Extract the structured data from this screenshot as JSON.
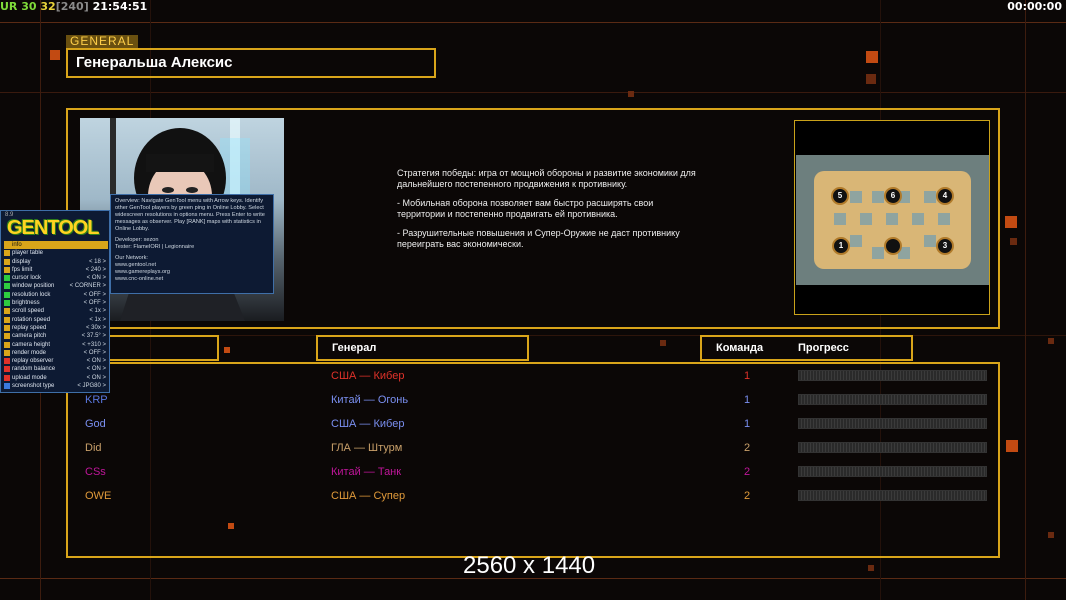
{
  "status": {
    "ur": "UR",
    "fps_a": "30",
    "fps_b": "32",
    "fps_cap": "[240]",
    "clock": "21:54:51",
    "game_time": "00:00:00"
  },
  "general": {
    "tag": "GENERAL",
    "name": "Генеральша Алексис",
    "strategy_paragraphs": [
      "Стратегия победы: игра от мощной обороны и развитие экономики для дальнейшего постепенного продвижения к противнику.",
      "- Мобильная оборона позволяет вам быстро расширять свои территории и постепенно продвигать ей противника.",
      "- Разрушительные повышения и Супер-Оружие не даст противнику переиграть вас экономически."
    ]
  },
  "map": {
    "spots": [
      "1",
      "2",
      "3",
      "4",
      "5",
      "6"
    ]
  },
  "table": {
    "headers": {
      "general": "Генерал",
      "team": "Команда",
      "progress": "Прогресс"
    },
    "rows": [
      {
        "name": "",
        "general": "США — Кибер",
        "team": "1",
        "name_color": "#e0322a",
        "general_color": "#e0322a"
      },
      {
        "name": "KRP",
        "general": "Китай — Огонь",
        "team": "1",
        "name_color": "#5a78e0",
        "general_color": "#7a8ff0"
      },
      {
        "name": "God",
        "general": "США — Кибер",
        "team": "1",
        "name_color": "#7a8ff0",
        "general_color": "#7a8ff0"
      },
      {
        "name": "Did",
        "general": "ГЛА — Штурм",
        "team": "2",
        "name_color": "#c9a06a",
        "general_color": "#c9a06a"
      },
      {
        "name": "CSs",
        "general": "Китай — Танк",
        "team": "2",
        "name_color": "#c0169a",
        "general_color": "#c0169a"
      },
      {
        "name": "OWE",
        "general": "США — Супер",
        "team": "2",
        "name_color": "#e09a3a",
        "general_color": "#e09a3a"
      }
    ]
  },
  "gentool": {
    "logo": "GENTOOL",
    "version": "8.9",
    "menu": [
      {
        "label": "info",
        "value": "",
        "color": "#d9a51a",
        "selected": true
      },
      {
        "label": "player table",
        "value": "",
        "color": "#d9a51a"
      },
      {
        "label": "display",
        "value": "< 18 >",
        "color": "#d9a51a"
      },
      {
        "label": "fps limit",
        "value": "< 240 >",
        "color": "#d9a51a"
      },
      {
        "label": "cursor lock",
        "value": "< ON >",
        "color": "#2ecc40"
      },
      {
        "label": "window position",
        "value": "< CORNER >",
        "color": "#2ecc40"
      },
      {
        "label": "resolution lock",
        "value": "< OFF >",
        "color": "#2ecc40"
      },
      {
        "label": "brightness",
        "value": "< OFF >",
        "color": "#2ecc40"
      },
      {
        "label": "scroll speed",
        "value": "< 1x >",
        "color": "#d9a51a"
      },
      {
        "label": "rotation speed",
        "value": "< 1x >",
        "color": "#d9a51a"
      },
      {
        "label": "replay speed",
        "value": "< 30x >",
        "color": "#d9a51a"
      },
      {
        "label": "camera pitch",
        "value": "< 37.5° >",
        "color": "#d9a51a"
      },
      {
        "label": "camera height",
        "value": "< +310 >",
        "color": "#d9a51a"
      },
      {
        "label": "render mode",
        "value": "< OFF >",
        "color": "#d9a51a"
      },
      {
        "label": "replay observer",
        "value": "< ON >",
        "color": "#e0322a"
      },
      {
        "label": "random balance",
        "value": "< ON >",
        "color": "#e0322a"
      },
      {
        "label": "upload mode",
        "value": "< ON >",
        "color": "#e0322a"
      },
      {
        "label": "screenshot type",
        "value": "< JPG80 >",
        "color": "#3a7ae0"
      }
    ],
    "help": [
      "Overview: Navigate GenTool menu with Arrow keys. Identify other GenTool players by green ping in Online Lobby. Select widescreen resolutions in options menu. Press Enter to write messages as observer. Play [RANK] maps with statistics in Online Lobby.",
      "Developer: xezon",
      "Tester: FlameIORI | Legionnaire",
      "Our Network:",
      "www.gentool.net",
      "www.gamereplays.org",
      "www.cnc-online.net"
    ]
  },
  "resolution_label": "2560 x 1440"
}
